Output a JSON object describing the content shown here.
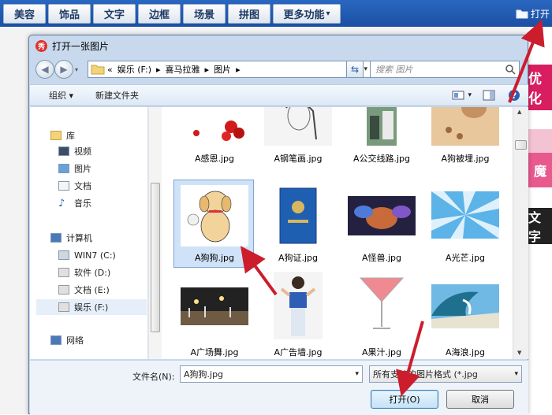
{
  "topbar": {
    "tabs": [
      "美容",
      "饰品",
      "文字",
      "边框",
      "场景",
      "拼图",
      "更多功能"
    ],
    "more_arrow": "▾",
    "open_label": "打开"
  },
  "right_strip": {
    "t1": "优化",
    "t2": "魔",
    "t3": "文字"
  },
  "dialog": {
    "title": "打开一张图片",
    "app_icon_text": "秀",
    "address": {
      "prefix": "«",
      "segments": [
        "娱乐 (F:)",
        "喜马拉雅",
        "图片"
      ]
    },
    "search_placeholder": "搜索 图片",
    "toolbar": {
      "organize": "组织 ▾",
      "new_folder": "新建文件夹"
    },
    "sidebar": {
      "library": "库",
      "library_items": [
        "视频",
        "图片",
        "文档",
        "音乐"
      ],
      "computer": "计算机",
      "drives": [
        "WIN7 (C:)",
        "软件 (D:)",
        "文档 (E:)",
        "娱乐 (F:)"
      ],
      "network": "网络"
    },
    "files": [
      {
        "name": "A感恩.jpg"
      },
      {
        "name": "A钢笔画.jpg"
      },
      {
        "name": "A公交线路.jpg"
      },
      {
        "name": "A狗被埋.jpg"
      },
      {
        "name": "A狗狗.jpg"
      },
      {
        "name": "A狗证.jpg"
      },
      {
        "name": "A怪兽.jpg"
      },
      {
        "name": "A光芒.jpg"
      },
      {
        "name": "A广场舞.jpg"
      },
      {
        "name": "A广告墙.jpg"
      },
      {
        "name": "A果汁.jpg"
      },
      {
        "name": "A海浪.jpg"
      }
    ],
    "selected_file": "A狗狗.jpg",
    "filename_label": "文件名(N):",
    "filename_value": "A狗狗.jpg",
    "filter": "所有支持的图片格式 (*.jpg",
    "open_button": "打开(O)",
    "cancel_button": "取消",
    "colors": {
      "accent": "#1b4fa3",
      "arrow": "#cc1d2d",
      "selection": "#cfe2f8"
    }
  }
}
